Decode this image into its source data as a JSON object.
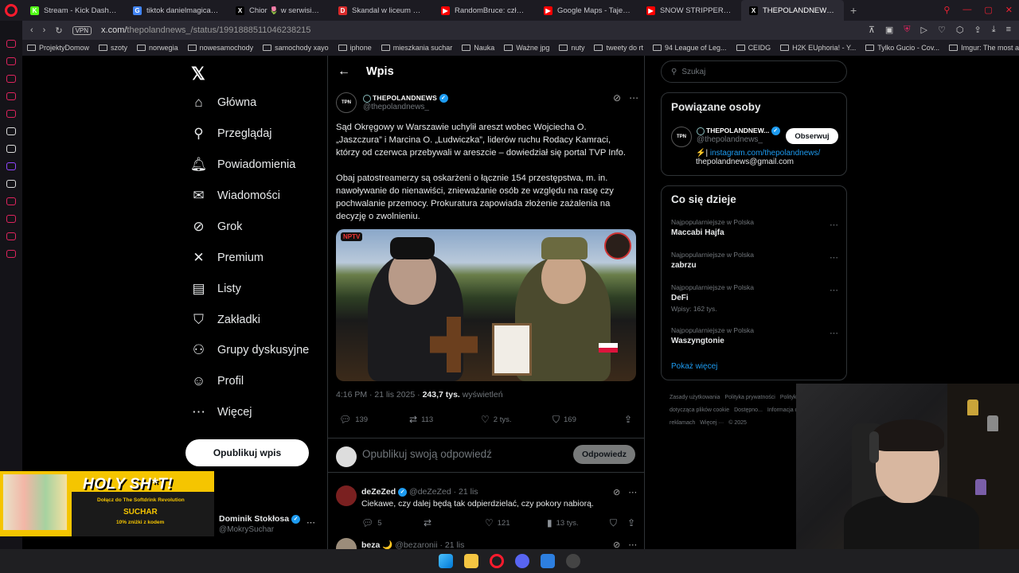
{
  "browser": {
    "tabs": [
      {
        "label": "Stream - Kick Dashboard",
        "favicon": "K",
        "color": "#53fc18",
        "active": false
      },
      {
        "label": "tiktok danielmagical - Sz...",
        "favicon": "G",
        "color": "#4285f4",
        "active": false
      },
      {
        "label": "Chior 🌷 w serwisie X: „I...",
        "favicon": "X",
        "color": "#000000",
        "active": false
      },
      {
        "label": "Skandal w liceum w Krak...",
        "favicon": "D",
        "color": "#d92b2b",
        "active": false
      },
      {
        "label": "RandomBruce: człowiek -...",
        "favicon": "▶",
        "color": "#ff0000",
        "active": false
      },
      {
        "label": "Google Maps - Tajemnic...",
        "favicon": "▶",
        "color": "#ff0000",
        "active": false
      },
      {
        "label": "SNOW STRIPPERS - Ul...",
        "favicon": "▶",
        "color": "#ff0000",
        "active": false
      },
      {
        "label": "THEPOLANDNEWS 🌐 w s...",
        "favicon": "X",
        "color": "#000000",
        "active": true
      }
    ],
    "vpn_label": "VPN",
    "url_host": "x.com/",
    "url_path": "thepolandnews_/status/1991888511046238215",
    "bookmarks": [
      "ProjektyDomow",
      "szoty",
      "norwegia",
      "nowesamochody",
      "samochody xayo",
      "iphone",
      "mieszkania suchar",
      "Nauka",
      "Ważne jpg",
      "nuty",
      "tweety do rt",
      "94 League of Leg...",
      "CEIDG",
      "H2K EUphoria! - Y...",
      "Tylko Gucio - Cov...",
      "Imgur: The most a..."
    ]
  },
  "nav": {
    "items": [
      {
        "label": "Główna",
        "icon": "home-icon",
        "glyph": "⌂"
      },
      {
        "label": "Przeglądaj",
        "icon": "search-icon",
        "glyph": "⚲"
      },
      {
        "label": "Powiadomienia",
        "icon": "bell-icon",
        "glyph": "🔔︎"
      },
      {
        "label": "Wiadomości",
        "icon": "mail-icon",
        "glyph": "✉"
      },
      {
        "label": "Grok",
        "icon": "grok-icon",
        "glyph": "⊘"
      },
      {
        "label": "Premium",
        "icon": "x-icon",
        "glyph": "✕"
      },
      {
        "label": "Listy",
        "icon": "list-icon",
        "glyph": "▤"
      },
      {
        "label": "Zakładki",
        "icon": "bookmark-icon",
        "glyph": "⛉"
      },
      {
        "label": "Grupy dyskusyjne",
        "icon": "people-icon",
        "glyph": "⚇"
      },
      {
        "label": "Profil",
        "icon": "person-icon",
        "glyph": "☺"
      },
      {
        "label": "Więcej",
        "icon": "more-circle-icon",
        "glyph": "⋯"
      }
    ],
    "post_button": "Opublikuj wpis"
  },
  "header": {
    "title": "Wpis"
  },
  "tweet": {
    "author_name": "THEPOLANDNEWS",
    "author_handle": "@thepolandnews_",
    "avatar_text": "TPN",
    "text1": "Sąd Okręgowy w Warszawie uchylił areszt wobec Wojciecha O. „Jaszczura” i Marcina O. „Ludwiczka”, liderów ruchu Rodacy Kamraci, którzy od czerwca przebywali w areszcie – dowiedział się portal TVP Info.",
    "text2": "Obaj patostreamerzy są oskarżeni o łącznie 154 przestępstwa, m. in. nawoływanie do nienawiści, znieważanie osób ze względu na rasę czy pochwalanie przemocy. Prokuratura zapowiada złożenie zażalenia na decyzję o zwolnieniu.",
    "media_logo": "NPTV",
    "time": "4:16 PM · 21 lis 2025 · ",
    "views": "243,7 tys.",
    "views_label": " wyświetleń",
    "replies": "139",
    "reposts": "113",
    "likes": "2 tys.",
    "bookmarks": "169"
  },
  "reply_box": {
    "placeholder": "Opublikuj swoją odpowiedź",
    "button": "Odpowiedz"
  },
  "comments": [
    {
      "name": "deZeZed",
      "handle": "@deZeZed · 21 lis",
      "text": "Ciekawe, czy dalej będą tak odpierdzielać, czy pokory nabiorą.",
      "replies": "5",
      "likes": "121",
      "views": "13 tys."
    },
    {
      "name": "beza 🌙",
      "handle": "@bezaronii · 21 lis",
      "text": "",
      "replies": "",
      "likes": "",
      "views": ""
    }
  ],
  "search": {
    "placeholder": "Szukaj"
  },
  "related": {
    "title": "Powiązane osoby",
    "name": "THEPOLANDNEW...",
    "handle": "@thepolandnews_",
    "follow": "Obserwuj",
    "bio_link": "instagram.com/thepolandnews/",
    "bio_prefix": "⚡|",
    "bio_email": "thepolandnews@gmail.com"
  },
  "trends": {
    "title": "Co się dzieje",
    "items": [
      {
        "category": "Najpopularniejsze w Polska",
        "topic": "Maccabi Hajfa",
        "count": ""
      },
      {
        "category": "Najpopularniejsze w Polska",
        "topic": "zabrzu",
        "count": ""
      },
      {
        "category": "Najpopularniejsze w Polska",
        "topic": "DeFi",
        "count": "Wpisy: 162 tys."
      },
      {
        "category": "Najpopularniejsze w Polska",
        "topic": "Waszyngtonie",
        "count": ""
      }
    ],
    "show_more": "Pokaż więcej"
  },
  "footer": [
    "Zasady użytkowania",
    "Polityka prywatności",
    "Polityka dotycząca plików cookie",
    "Dostępno...",
    "Informacja o reklamach",
    "Więcej ···",
    "© 2025"
  ],
  "ad": {
    "headline": "HOLY SH*T!",
    "line1": "Dołącz do The Softdrink Revolution",
    "brand": "SUCHAR",
    "line3": "10% zniżki z kodem",
    "user_name": "Dominik Stokłosa",
    "user_handle": "@MokrySuchar"
  },
  "colors": {
    "accent": "#1d9bf0",
    "background": "#000000",
    "opera_red": "#ff1b2d"
  }
}
